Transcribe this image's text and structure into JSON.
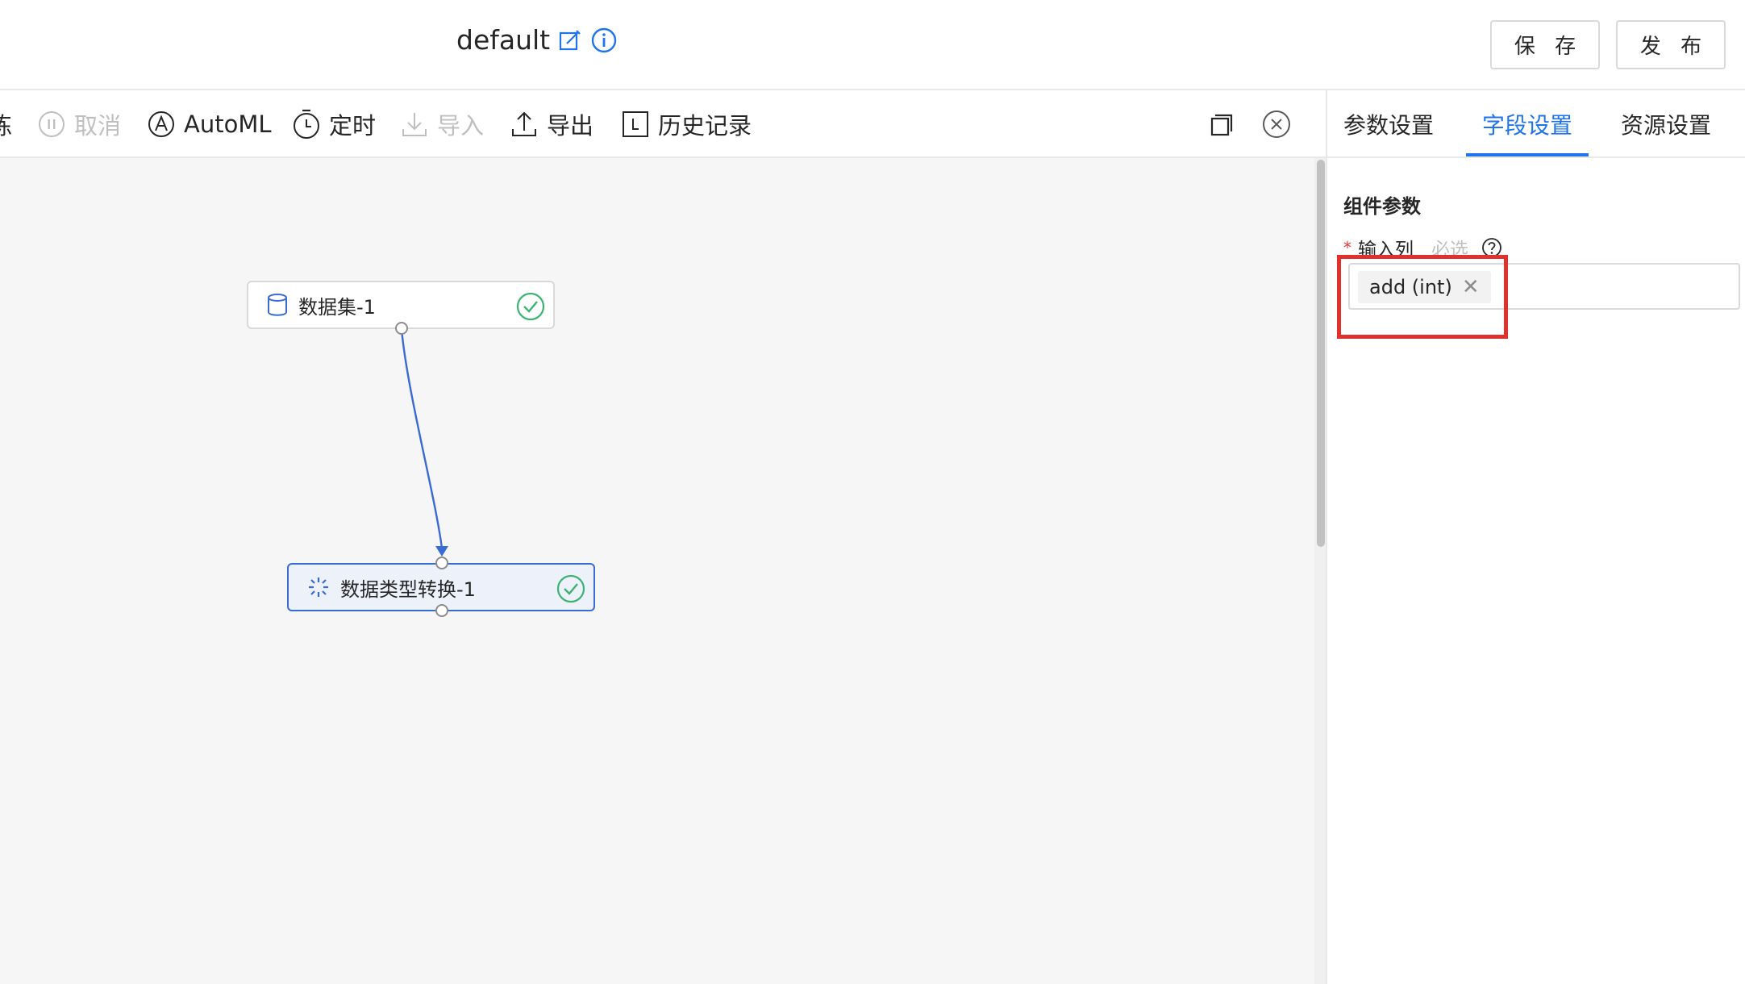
{
  "header": {
    "title": "default",
    "save_label": "保 存",
    "publish_label": "发 布"
  },
  "toolbar": {
    "items": [
      {
        "label": "练",
        "icon": "train-icon",
        "disabled": false
      },
      {
        "label": "取消",
        "icon": "pause-circle-icon",
        "disabled": true
      },
      {
        "label": "AutoML",
        "icon": "automl-icon",
        "disabled": false
      },
      {
        "label": "定时",
        "icon": "timer-icon",
        "disabled": false
      },
      {
        "label": "导入",
        "icon": "import-icon",
        "disabled": true
      },
      {
        "label": "导出",
        "icon": "export-icon",
        "disabled": false
      },
      {
        "label": "历史记录",
        "icon": "history-icon",
        "disabled": false
      }
    ]
  },
  "canvas": {
    "nodes": [
      {
        "label": "数据集-1",
        "icon": "database-icon",
        "status": "success"
      },
      {
        "label": "数据类型转换-1",
        "icon": "transform-icon",
        "status": "success",
        "selected": true
      }
    ]
  },
  "panel": {
    "tabs": [
      {
        "label": "参数设置",
        "active": false
      },
      {
        "label": "字段设置",
        "active": true
      },
      {
        "label": "资源设置",
        "active": false
      }
    ],
    "section_title": "组件参数",
    "field": {
      "required_mark": "*",
      "label": "输入列",
      "hint": "必选",
      "selected_tag": "add (int)",
      "tag_close": "✕"
    }
  },
  "colors": {
    "accent": "#1f74ec",
    "success": "#3cb371",
    "highlight": "#e0322b"
  }
}
